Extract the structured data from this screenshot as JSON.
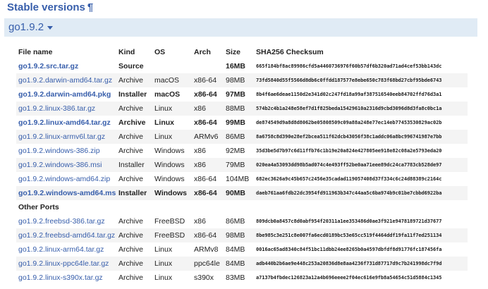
{
  "heading": {
    "title": "Stable versions",
    "anchor": "¶"
  },
  "version_selector": {
    "label": "go1.9.2"
  },
  "table": {
    "headers": [
      "File name",
      "Kind",
      "OS",
      "Arch",
      "Size",
      "SHA256 Checksum"
    ],
    "rows": [
      {
        "file": "go1.9.2.src.tar.gz",
        "kind": "Source",
        "os": "",
        "arch": "",
        "size": "16MB",
        "checksum": "665f184bf8ac89986cfd5a4460736976f60b57df6b320ad71ad4cef53bb143dc",
        "highlight": true
      },
      {
        "file": "go1.9.2.darwin-amd64.tar.gz",
        "kind": "Archive",
        "os": "macOS",
        "arch": "x86-64",
        "size": "98MB",
        "checksum": "73fd5840d55f5566d8db6c0ffdd187577e8ebe650c783f68bd27cbf95bde6743",
        "highlight": false
      },
      {
        "file": "go1.9.2.darwin-amd64.pkg",
        "kind": "Installer",
        "os": "macOS",
        "arch": "x86-64",
        "size": "97MB",
        "checksum": "8b4f6ae6deae1150d2e341d02c247fd18a99af387516540eeb84702ffd76d3a1",
        "highlight": true
      },
      {
        "file": "go1.9.2.linux-386.tar.gz",
        "kind": "Archive",
        "os": "Linux",
        "arch": "x86",
        "size": "88MB",
        "checksum": "574b2c4b1a248e58ef7d1f825beda15429610a2316d9cbd3096d8d3fa8c0bc1a",
        "highlight": false
      },
      {
        "file": "go1.9.2.linux-amd64.tar.gz",
        "kind": "Archive",
        "os": "Linux",
        "arch": "x86-64",
        "size": "99MB",
        "checksum": "de874549d9a8d8d8062be05808509c09a88a248e77ec14eb77453530829ac02b",
        "highlight": true
      },
      {
        "file": "go1.9.2.linux-armv6l.tar.gz",
        "kind": "Archive",
        "os": "Linux",
        "arch": "ARMv6",
        "size": "86MB",
        "checksum": "8a6758c8d390e28ef2bcea511f62dcb43056f38c1addc06a8bc996741987e7bb",
        "highlight": false
      },
      {
        "file": "go1.9.2.windows-386.zip",
        "kind": "Archive",
        "os": "Windows",
        "arch": "x86",
        "size": "92MB",
        "checksum": "35d3be5d7b97c6d11ffb76c1b19e20a824e427805ee918e82c08a2e5793eda20",
        "highlight": false
      },
      {
        "file": "go1.9.2.windows-386.msi",
        "kind": "Installer",
        "os": "Windows",
        "arch": "x86",
        "size": "79MB",
        "checksum": "020ea4a53093dd98b5ad074c4e493ff52be0aa71eee89dc24ca7783cb528de97",
        "highlight": false
      },
      {
        "file": "go1.9.2.windows-amd64.zip",
        "kind": "Archive",
        "os": "Windows",
        "arch": "x86-64",
        "size": "104MB",
        "checksum": "682ec3626a9c45b657c2456e35cadad119057408d37f334c6c24d88389c2164c",
        "highlight": false
      },
      {
        "file": "go1.9.2.windows-amd64.msi",
        "kind": "Installer",
        "os": "Windows",
        "arch": "x86-64",
        "size": "90MB",
        "checksum": "daeb761aa6fdb22dc3954fd911963b347c44aa5c6ba974b9c01be7cbbd6922ba",
        "highlight": true
      }
    ],
    "other_ports_label": "Other Ports",
    "other_rows": [
      {
        "file": "go1.9.2.freebsd-386.tar.gz",
        "kind": "Archive",
        "os": "FreeBSD",
        "arch": "x86",
        "size": "86MB",
        "checksum": "809dcb0a8457c8d0abf954f20311a1ee353486d0ae3f921e9478189721d37677",
        "highlight": false
      },
      {
        "file": "go1.9.2.freebsd-amd64.tar.gz",
        "kind": "Archive",
        "os": "FreeBSD",
        "arch": "x86-64",
        "size": "98MB",
        "checksum": "8be985c3e251c8e007fa6ecd0189bc53e65cc519f4464ddf19fa11f7ed251134",
        "highlight": false
      },
      {
        "file": "go1.9.2.linux-arm64.tar.gz",
        "kind": "Archive",
        "os": "Linux",
        "arch": "ARMv8",
        "size": "84MB",
        "checksum": "0016ac65ad8340c84f51bc11dbb24ee8265b0a4597dbfdf8d91776fc187456fa",
        "highlight": false
      },
      {
        "file": "go1.9.2.linux-ppc64le.tar.gz",
        "kind": "Archive",
        "os": "Linux",
        "arch": "ppc64le",
        "size": "84MB",
        "checksum": "adb440b2b6ae9e448c253a20836d8e8aa4236f731d87717d9c7b241998dc7f9d",
        "highlight": false
      },
      {
        "file": "go1.9.2.linux-s390x.tar.gz",
        "kind": "Archive",
        "os": "Linux",
        "arch": "s390x",
        "size": "83MB",
        "checksum": "a7137b4fbdec126823a12a4b696eeee2f04ec616e9fb8a54654c51d5884c1345",
        "highlight": false
      }
    ]
  }
}
